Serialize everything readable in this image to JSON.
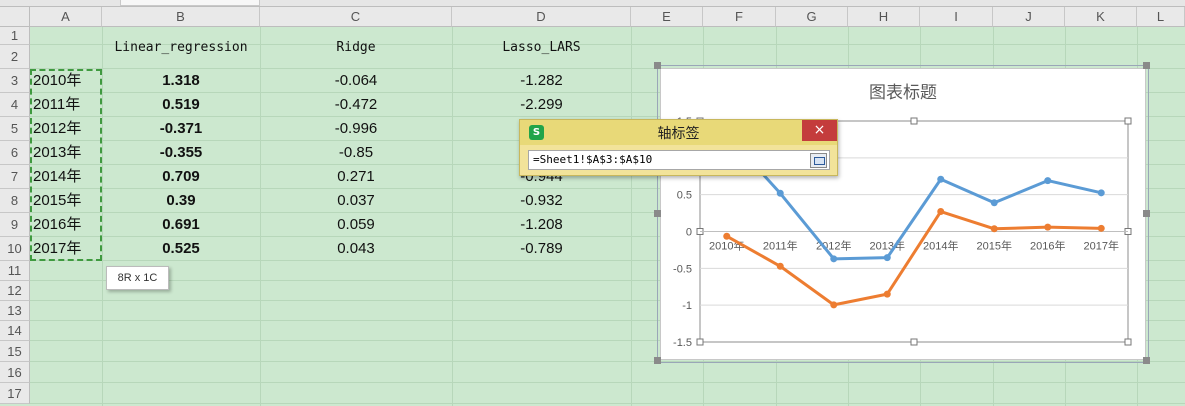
{
  "sheet": {
    "columns": [
      "A",
      "B",
      "C",
      "D",
      "E",
      "F",
      "G",
      "H",
      "I",
      "J",
      "K",
      "L"
    ],
    "rows": [
      "1",
      "2",
      "3",
      "4",
      "5",
      "6",
      "7",
      "8",
      "9",
      "10",
      "11",
      "12",
      "13",
      "14",
      "15",
      "16",
      "17"
    ],
    "headers": {
      "b": "Linear_regression",
      "c": "Ridge",
      "d": "Lasso_LARS"
    },
    "data": [
      {
        "year": "2010年",
        "b": "1.318",
        "c": "-0.064",
        "d": "-1.282"
      },
      {
        "year": "2011年",
        "b": "0.519",
        "c": "-0.472",
        "d": "-2.299"
      },
      {
        "year": "2012年",
        "b": "-0.371",
        "c": "-0.996",
        "d": ""
      },
      {
        "year": "2013年",
        "b": "-0.355",
        "c": "-0.85",
        "d": ""
      },
      {
        "year": "2014年",
        "b": "0.709",
        "c": "0.271",
        "d": "-0.944"
      },
      {
        "year": "2015年",
        "b": "0.39",
        "c": "0.037",
        "d": "-0.932"
      },
      {
        "year": "2016年",
        "b": "0.691",
        "c": "0.059",
        "d": "-1.208"
      },
      {
        "year": "2017年",
        "b": "0.525",
        "c": "0.043",
        "d": "-0.789"
      }
    ],
    "selection_tip": "8R x 1C"
  },
  "dialog": {
    "title": "轴标签",
    "logo": "S",
    "close": "×",
    "value": "=Sheet1!$A$3:$A$10"
  },
  "chart_data": {
    "type": "line",
    "title": "图表标题",
    "categories": [
      "2010年",
      "2011年",
      "2012年",
      "2013年",
      "2014年",
      "2015年",
      "2016年",
      "2017年"
    ],
    "series": [
      {
        "values": [
          1.318,
          0.519,
          -0.371,
          -0.355,
          0.709,
          0.39,
          0.691,
          0.525
        ],
        "color": "#5b9bd5"
      },
      {
        "values": [
          -0.064,
          -0.472,
          -0.996,
          -0.85,
          0.271,
          0.037,
          0.059,
          0.043
        ],
        "color": "#ed7d31"
      }
    ],
    "ylim": [
      -1.5,
      1.5
    ],
    "yticks": [
      "1.5",
      "1",
      "0.5",
      "0",
      "-0.5",
      "-1",
      "-1.5"
    ],
    "grid": true,
    "legend": "none"
  }
}
